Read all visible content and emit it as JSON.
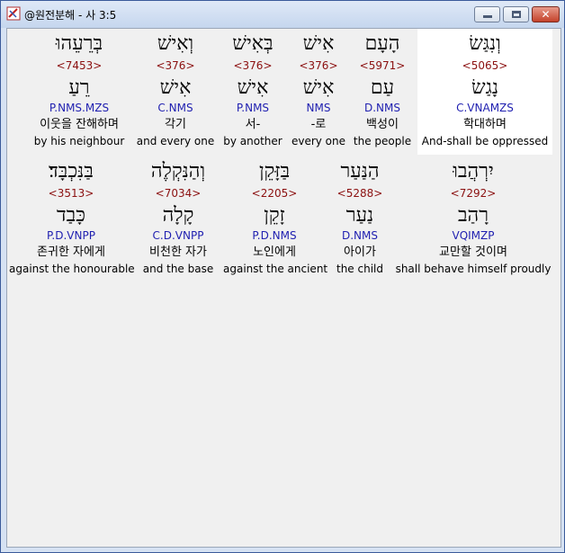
{
  "window": {
    "title": "@원전분해 - 사 3:5"
  },
  "controls": {
    "minimize": "",
    "maximize": "",
    "close": "✕"
  },
  "rows": [
    {
      "words": [
        {
          "heb": "וְנִגַּשׂ",
          "strong": "<5065>",
          "lemma": "נָגַשׂ",
          "morph": "C.VNAMZS",
          "ko": "학대하며",
          "en": "And-shall be oppressed",
          "highlight": true
        },
        {
          "heb": "הָעָם",
          "strong": "<5971>",
          "lemma": "עַם",
          "morph": "D.NMS",
          "ko": "백성이",
          "en": "the people"
        },
        {
          "heb": "אִישׁ",
          "strong": "<376>",
          "lemma": "אִישׁ",
          "morph": "NMS",
          "ko": "-로",
          "en": "every one"
        },
        {
          "heb": "בְּאִישׁ",
          "strong": "<376>",
          "lemma": "אִישׁ",
          "morph": "P.NMS",
          "ko": "서-",
          "en": "by another"
        },
        {
          "heb": "וְאִישׁ",
          "strong": "<376>",
          "lemma": "אִישׁ",
          "morph": "C.NMS",
          "ko": "각기",
          "en": "and every one"
        },
        {
          "heb": "בְּרֵעֵהוּ",
          "strong": "<7453>",
          "lemma": "רֵעַ",
          "morph": "P.NMS.MZS",
          "ko": "이웃을 잔해하며",
          "en": "by his neighbour"
        }
      ]
    },
    {
      "words": [
        {
          "heb": "יִרְהֲבוּ",
          "strong": "<7292>",
          "lemma": "רָהַב",
          "morph": "VQIMZP",
          "ko": "교만할 것이며",
          "en": "shall behave himself proudly"
        },
        {
          "heb": "הַנַּעַר",
          "strong": "<5288>",
          "lemma": "נַעַר",
          "morph": "D.NMS",
          "ko": "아이가",
          "en": "the child"
        },
        {
          "heb": "בַּזָּקֵן",
          "strong": "<2205>",
          "lemma": "זָקֵן",
          "morph": "P.D.NMS",
          "ko": "노인에게",
          "en": "against the ancient"
        },
        {
          "heb": "וְהַנִּקְלֶה",
          "strong": "<7034>",
          "lemma": "קָלָה",
          "morph": "C.D.VNPP",
          "ko": "비천한 자가",
          "en": "and the base"
        },
        {
          "heb": "בַּנִּכְבָּד׃",
          "strong": "<3513>",
          "lemma": "כָּבַד",
          "morph": "P.D.VNPP",
          "ko": "존귀한 자에게",
          "en": "against the honourable"
        }
      ]
    }
  ]
}
